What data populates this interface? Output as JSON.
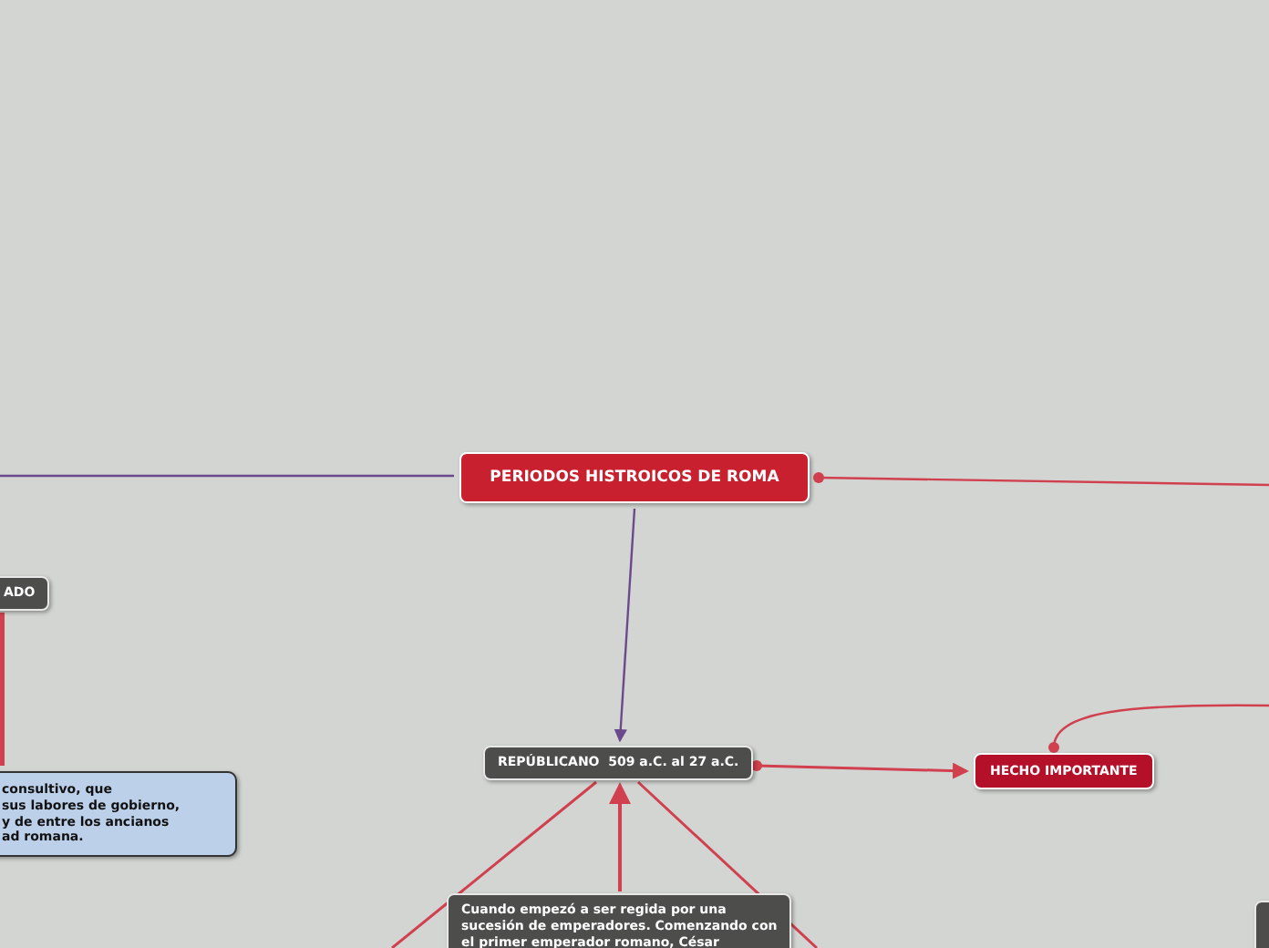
{
  "mind_map": {
    "nodes": [
      {
        "kind": "root",
        "text": "PERIODOS HISTROICOS DE ROMA"
      },
      {
        "kind": "topic",
        "text": "ADO"
      },
      {
        "kind": "note",
        "text": "consultivo, que\nsus labores de gobierno,\ny de entre los ancianos\nad romana."
      },
      {
        "kind": "topic",
        "text": "REPÚBLICANO  509 a.C. al 27 a.C."
      },
      {
        "kind": "highlight",
        "text": "HECHO IMPORTANTE"
      },
      {
        "kind": "topic",
        "text": "Cuando empezó a ser regida por una\nsucesión de emperadores. Comenzando con\nel primer emperador romano, César"
      },
      {
        "kind": "stub"
      }
    ]
  }
}
